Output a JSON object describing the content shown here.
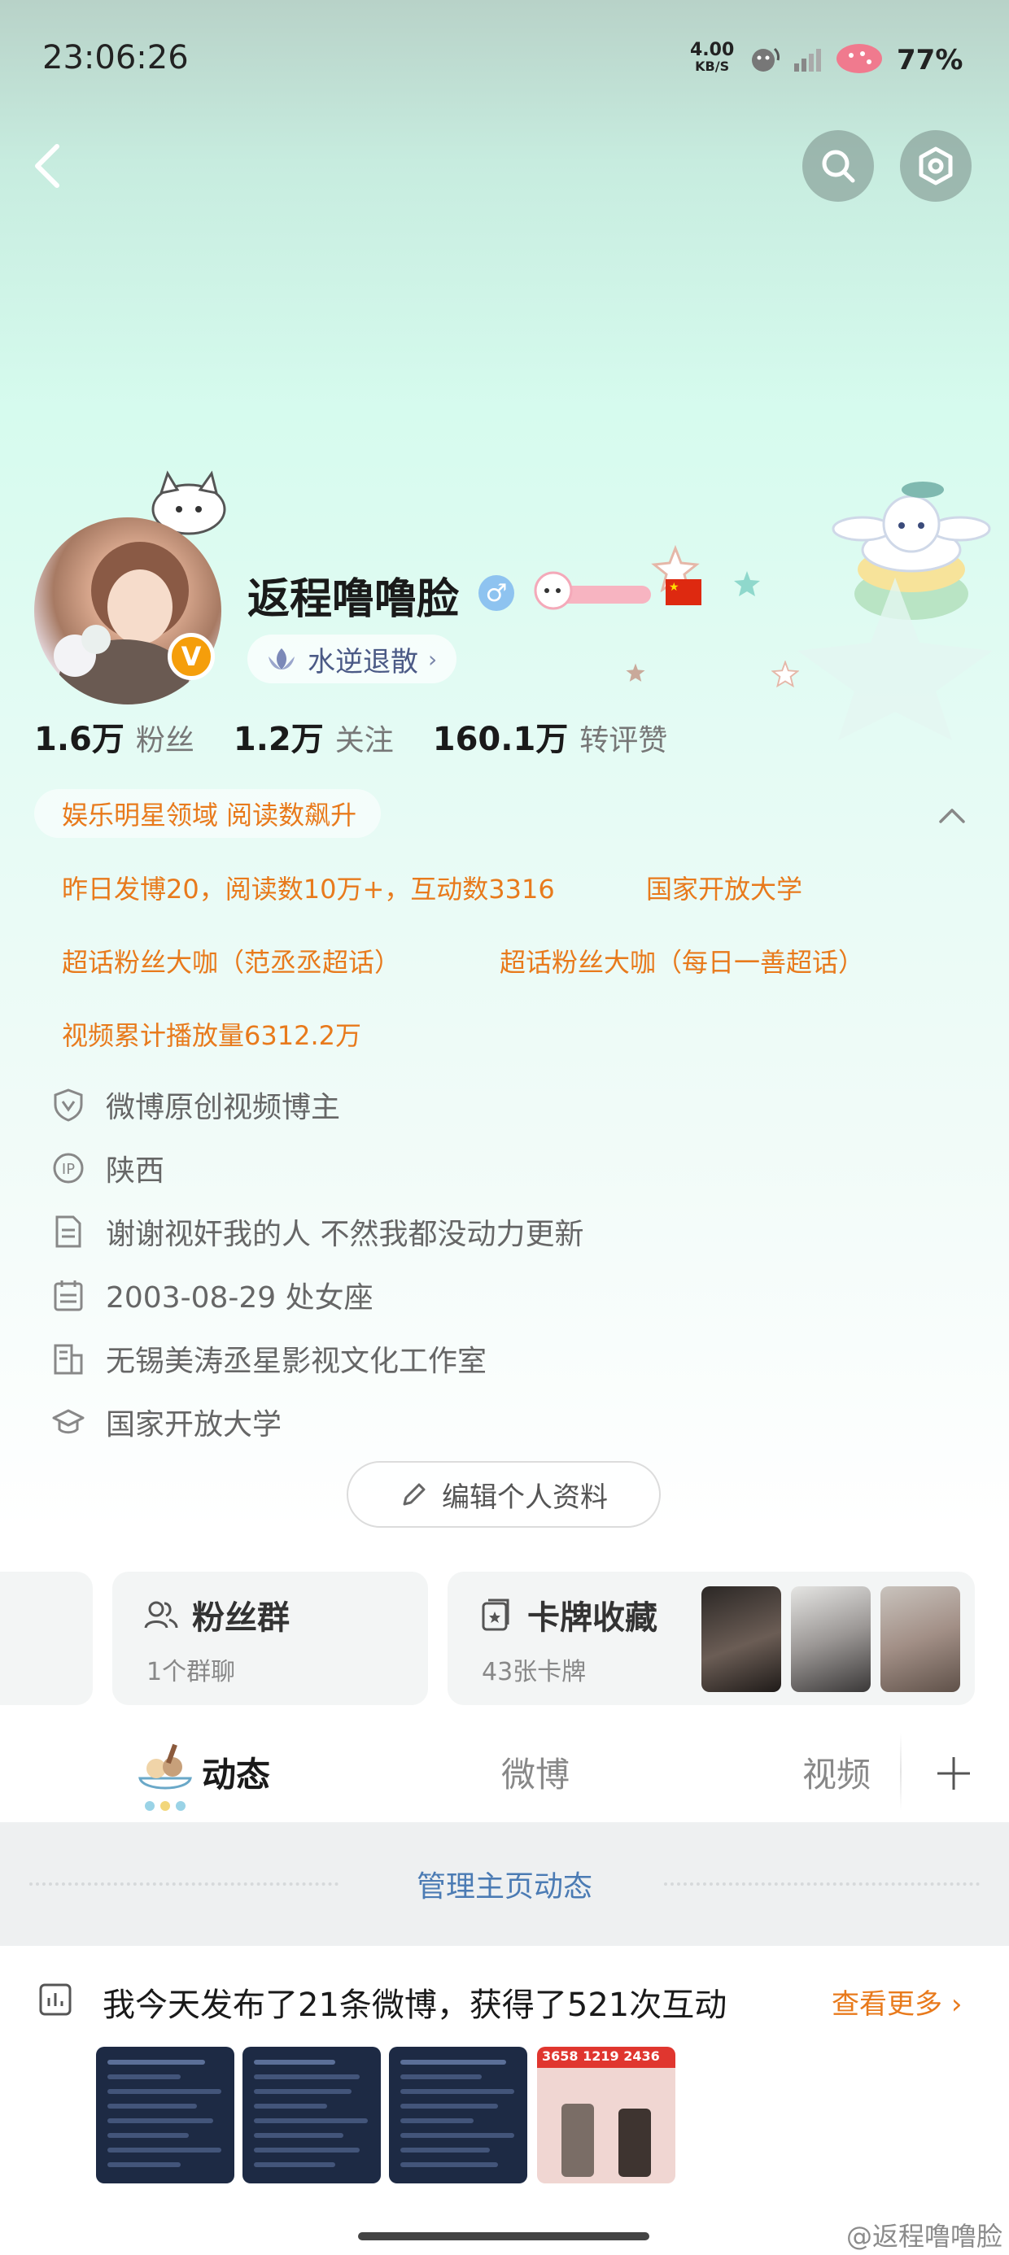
{
  "status_bar": {
    "time": "23:06:26",
    "net_speed_value": "4.00",
    "net_speed_unit": "KB/S",
    "battery": "77%"
  },
  "profile": {
    "name": "返程噜噜脸",
    "group_label": "水逆退散",
    "stats": [
      {
        "value": "1.6万",
        "label": "粉丝"
      },
      {
        "value": "1.2万",
        "label": "关注"
      },
      {
        "value": "160.1万",
        "label": "转评赞"
      }
    ]
  },
  "tags": {
    "first": "娱乐明星领域 阅读数飙升",
    "items": [
      "昨日发博20，阅读数10万+，互动数3316",
      "国家开放大学",
      "超话粉丝大咖（范丞丞超话）",
      "超话粉丝大咖（每日一善超话）",
      "视频累计播放量6312.2万"
    ]
  },
  "info": [
    {
      "icon": "shield-v-icon",
      "text": "微博原创视频博主"
    },
    {
      "icon": "ip-icon",
      "text": "陕西"
    },
    {
      "icon": "document-icon",
      "text": "谢谢视奸我的人 不然我都没动力更新"
    },
    {
      "icon": "calendar-icon",
      "text": "2003-08-29 处女座"
    },
    {
      "icon": "company-icon",
      "text": "无锡美涛丞星影视文化工作室"
    },
    {
      "icon": "graduation-cap-icon",
      "text": "国家开放大学"
    }
  ],
  "edit_profile_label": "编辑个人资料",
  "cards": {
    "fan_group": {
      "title": "粉丝群",
      "subtitle": "1个群聊"
    },
    "card_collection": {
      "title": "卡牌收藏",
      "subtitle": "43张卡牌"
    }
  },
  "tabs": [
    "动态",
    "微博",
    "视频"
  ],
  "manage_label": "管理主页动态",
  "summary": {
    "text": "我今天发布了21条微博，获得了521次互动",
    "see_more": "查看更多"
  },
  "thumb_red_stats": "3658 1219 2436",
  "watermark": "@返程噜噜脸",
  "colors": {
    "accent_orange": "#e87a1c",
    "link_blue": "#4b7bb4",
    "verified_orange": "#f59e0b"
  }
}
